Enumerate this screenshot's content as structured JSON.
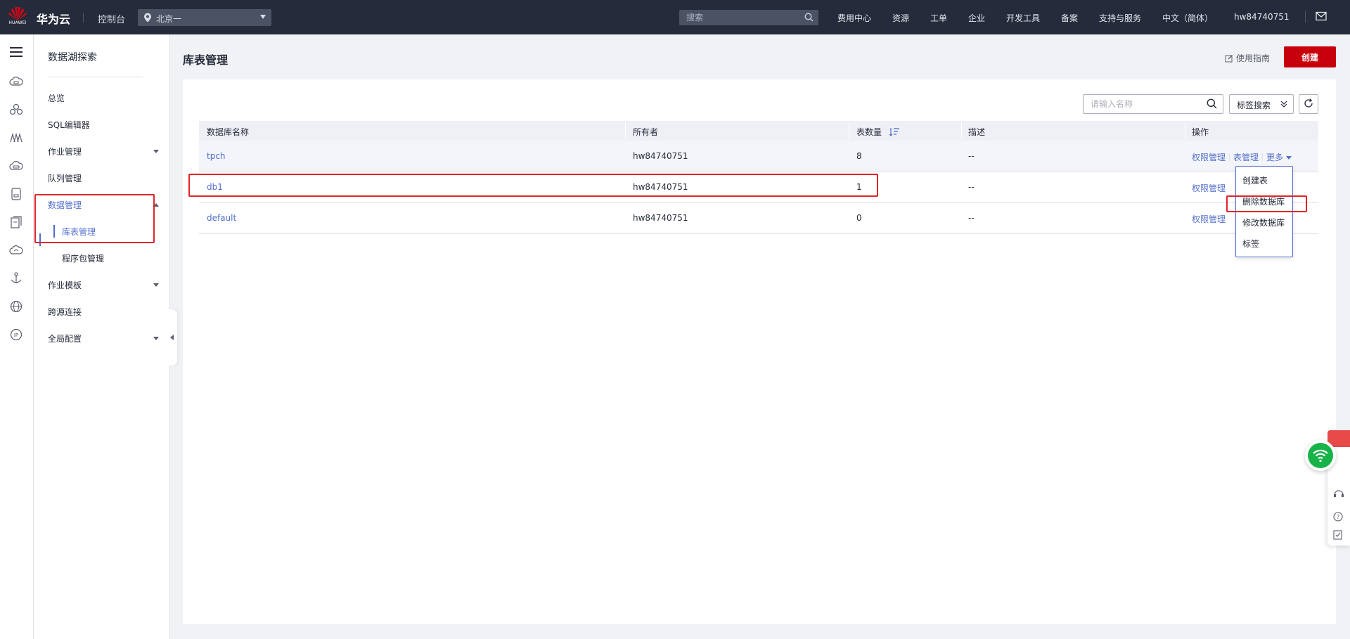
{
  "topbar": {
    "logo_text": "HUAWEI",
    "brand": "华为云",
    "console": "控制台",
    "region": "北京一",
    "search_placeholder": "搜索",
    "nav": [
      "费用中心",
      "资源",
      "工单",
      "企业",
      "开发工具",
      "备案",
      "支持与服务",
      "中文（简体）",
      "hw84740751"
    ],
    "icons": [
      "location-pin-icon",
      "search-icon",
      "mail-icon"
    ]
  },
  "rail": {
    "icons": [
      "hamburger-menu-icon",
      "cloud-server-icon",
      "cluster-icon",
      "data-lake-icon",
      "cloud-db-icon",
      "storage-icon",
      "document-icon",
      "cloud-icon",
      "anchor-icon",
      "globe-icon",
      "ip-icon"
    ]
  },
  "sidemenu": {
    "title": "数据湖探索",
    "items": [
      {
        "label": "总览"
      },
      {
        "label": "SQL编辑器"
      },
      {
        "label": "作业管理"
      },
      {
        "label": "队列管理"
      },
      {
        "label": "数据管理"
      },
      {
        "label": "库表管理"
      },
      {
        "label": "程序包管理"
      },
      {
        "label": "作业模板"
      },
      {
        "label": "跨源连接"
      },
      {
        "label": "全局配置"
      }
    ]
  },
  "page": {
    "title": "库表管理",
    "guide": "使用指南",
    "create": "创建"
  },
  "toolbar": {
    "name_placeholder": "请输入名称",
    "tag_search": "标签搜索"
  },
  "table": {
    "headers": [
      "数据库名称",
      "所有者",
      "表数量",
      "描述",
      "操作"
    ],
    "rows": [
      {
        "name": "tpch",
        "owner": "hw84740751",
        "count": "8",
        "desc": "--"
      },
      {
        "name": "db1",
        "owner": "hw84740751",
        "count": "1",
        "desc": "--"
      },
      {
        "name": "default",
        "owner": "hw84740751",
        "count": "0",
        "desc": "--"
      }
    ],
    "ops": {
      "perm": "权限管理",
      "table_mgmt": "表管理",
      "more": "更多"
    }
  },
  "dropdown": {
    "items": [
      "创建表",
      "删除数据库",
      "修改数据库",
      "标签"
    ]
  },
  "colors": {
    "topbar": "#252b3a",
    "brand_red": "#c7000b",
    "link_blue": "#526ecc",
    "annotation_red": "#e0252b",
    "wifi_green": "#17b349"
  }
}
